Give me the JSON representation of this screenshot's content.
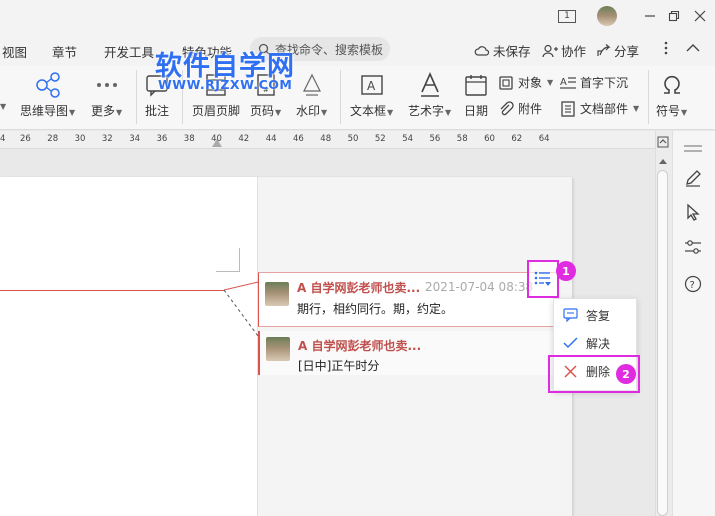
{
  "titlebar": {
    "page_indicator": "1",
    "controls": [
      "minimize-icon",
      "restore-icon",
      "close-icon"
    ]
  },
  "menu": {
    "tabs": [
      {
        "label": "视图"
      },
      {
        "label": "章节"
      },
      {
        "label": "开发工具"
      },
      {
        "label": "特色功能"
      }
    ],
    "search_placeholder": "查找命令、搜索模板",
    "right": {
      "unsaved": "未保存",
      "collab": "协作",
      "share": "分享"
    }
  },
  "watermark": {
    "title": "软件自学网",
    "url": "WWW.RJZXW.COM"
  },
  "ribbon": {
    "mindmap": "思维导图",
    "more": "更多",
    "comment": "批注",
    "header_footer": "页眉页脚",
    "page_number": "页码",
    "watermark": "水印",
    "textbox": "文本框",
    "wordart": "艺术字",
    "date": "日期",
    "object": "对象",
    "attachment": "附件",
    "dropcap": "首字下沉",
    "doc_parts": "文档部件",
    "symbol": "符号"
  },
  "ruler": {
    "ticks": [
      "4",
      "26",
      "28",
      "30",
      "32",
      "34",
      "36",
      "38",
      "40",
      "42",
      "44",
      "46",
      "48",
      "50",
      "52",
      "54",
      "56",
      "58",
      "60",
      "62",
      "64"
    ]
  },
  "comments": [
    {
      "author": "A 自学网彭老师也卖...",
      "date": "2021-07-04 08:38",
      "text": "期行，相约同行。期，约定。"
    },
    {
      "author": "A 自学网彭老师也卖...",
      "date": "",
      "text": "[日中]正午时分"
    }
  ],
  "context_menu": {
    "reply": "答复",
    "resolve": "解决",
    "delete": "删除"
  },
  "callouts": {
    "step1": "1",
    "step2": "2"
  },
  "colors": {
    "accent_magenta": "#e02ce0",
    "author_red": "#c0504d",
    "watermark_blue": "#2f6ff2"
  }
}
